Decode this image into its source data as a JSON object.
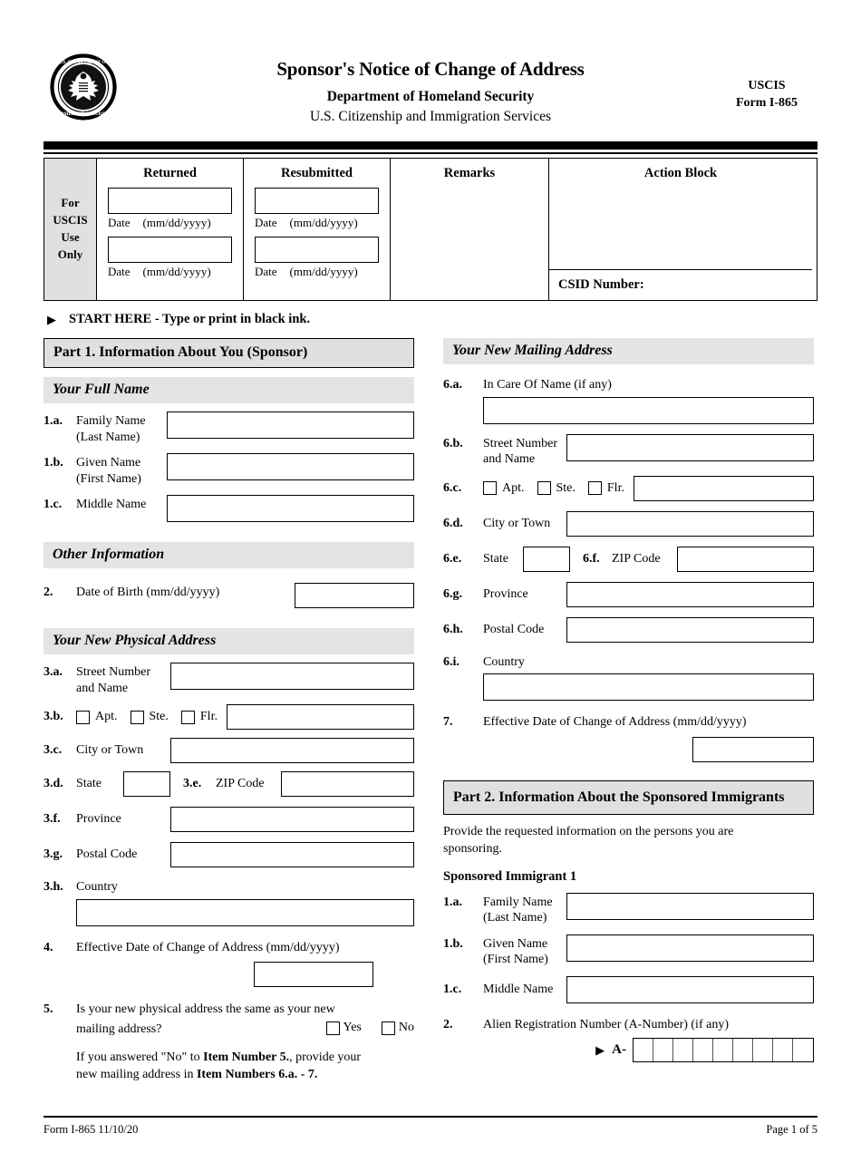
{
  "header": {
    "seal_alt": "dhs-seal",
    "title": "Sponsor's Notice of Change of Address",
    "subtitle1": "Department of Homeland Security",
    "subtitle2": "U.S. Citizenship and Immigration Services",
    "agency": "USCIS",
    "form_number": "Form I-865"
  },
  "uscis_use": {
    "label": "For\nUSCIS\nUse\nOnly",
    "label_lines": [
      "For",
      "USCIS",
      "Use",
      "Only"
    ],
    "columns": {
      "returned": "Returned",
      "resubmitted": "Resubmitted",
      "remarks": "Remarks",
      "action_block": "Action Block"
    },
    "date_label": "Date",
    "date_format": "(mm/dd/yyyy)",
    "csid_label": "CSID Number:"
  },
  "start_here": {
    "arrow": "triangle-right-icon",
    "text": "START HERE - Type or print in black ink."
  },
  "part1": {
    "heading": "Part 1.  Information About You (Sponsor)",
    "full_name_heading": "Your Full Name",
    "fields": {
      "f1a_num": "1.a.",
      "f1a_label_l1": "Family Name",
      "f1a_label_l2": "(Last Name)",
      "f1b_num": "1.b.",
      "f1b_label_l1": "Given Name",
      "f1b_label_l2": "(First Name)",
      "f1c_num": "1.c.",
      "f1c_label": "Middle Name"
    },
    "other_info_heading": "Other Information",
    "dob_num": "2.",
    "dob_label": "Date of Birth (mm/dd/yyyy)",
    "physical_address_heading": "Your New Physical Address",
    "physical": {
      "f3a_num": "3.a.",
      "f3a_label_l1": "Street Number",
      "f3a_label_l2": "and Name",
      "f3b_num": "3.b.",
      "apt": "Apt.",
      "ste": "Ste.",
      "flr": "Flr.",
      "f3c_num": "3.c.",
      "f3c_label": "City or Town",
      "f3d_num": "3.d.",
      "f3d_label": "State",
      "f3e_num": "3.e.",
      "f3e_label": "ZIP Code",
      "f3f_num": "3.f.",
      "f3f_label": "Province",
      "f3g_num": "3.g.",
      "f3g_label": "Postal Code",
      "f3h_num": "3.h.",
      "f3h_label": "Country"
    },
    "f4_num": "4.",
    "f4_label": "Effective Date of Change of Address (mm/dd/yyyy)",
    "f5_num": "5.",
    "f5_label_l1": "Is your new physical address the same as your new",
    "f5_label_l2": "mailing address?",
    "yes": "Yes",
    "no": "No",
    "f5_note_l1": "If you answered \"No\" to Item Number 5., provide your",
    "f5_note_l2": "new mailing address in Item Numbers 6.a. - 7.",
    "f5_note_plain_1": "If you answered \"No\" to ",
    "f5_note_bold_1": "Item Number 5.",
    "f5_note_plain_2": ", provide your",
    "f5_note_plain_3": "new mailing address in ",
    "f5_note_bold_2": "Item Numbers 6.a. - 7."
  },
  "mailing": {
    "heading": "Your New Mailing Address",
    "f6a_num": "6.a.",
    "f6a_label": "In Care Of Name (if any)",
    "f6b_num": "6.b.",
    "f6b_label_l1": "Street Number",
    "f6b_label_l2": "and Name",
    "f6c_num": "6.c.",
    "apt": "Apt.",
    "ste": "Ste.",
    "flr": "Flr.",
    "f6d_num": "6.d.",
    "f6d_label": "City or Town",
    "f6e_num": "6.e.",
    "f6e_label": "State",
    "f6f_num": "6.f.",
    "f6f_label": "ZIP Code",
    "f6g_num": "6.g.",
    "f6g_label": "Province",
    "f6h_num": "6.h.",
    "f6h_label": "Postal Code",
    "f6i_num": "6.i.",
    "f6i_label": "Country",
    "f7_num": "7.",
    "f7_label": "Effective Date of Change of Address (mm/dd/yyyy)"
  },
  "part2": {
    "heading": "Part 2.  Information About the Sponsored Immigrants",
    "intro_l1": "Provide the requested information on the persons you are",
    "intro_l2": "sponsoring.",
    "immigrant_heading": "Sponsored Immigrant 1",
    "f1a_num": "1.a.",
    "f1a_label_l1": "Family Name",
    "f1a_label_l2": "(Last Name)",
    "f1b_num": "1.b.",
    "f1b_label_l1": "Given Name",
    "f1b_label_l2": "(First Name)",
    "f1c_num": "1.c.",
    "f1c_label": "Middle Name",
    "f2_num": "2.",
    "f2_label": "Alien Registration Number (A-Number) (if any)",
    "a_prefix": "A-",
    "a_cells": 9
  },
  "footer": {
    "left": "Form I-865  11/10/20",
    "right": "Page 1 of 5"
  }
}
